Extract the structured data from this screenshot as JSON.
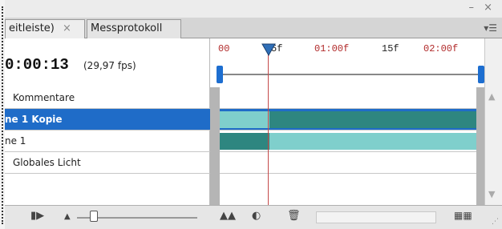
{
  "window": {
    "minimize_label": "–",
    "close_label": "×"
  },
  "tabs": [
    {
      "label": "eitleiste)",
      "close": "×"
    },
    {
      "label": "Messprotokoll"
    }
  ],
  "menu_icon": "panel-menu-icon",
  "timecode": "0:00:13",
  "fps": "(29,97 fps)",
  "ruler": {
    "ticks": [
      "00",
      "5f",
      "01:00f",
      "15f",
      "02:00f"
    ]
  },
  "layers": [
    {
      "name": "Kommentare",
      "selected": false
    },
    {
      "name": "ne 1 Kopie",
      "selected": true
    },
    {
      "name": "ne 1",
      "selected": false
    },
    {
      "name": "Globales Licht",
      "selected": false
    }
  ],
  "colors": {
    "selection": "#1f6cc8",
    "playhead": "#c54a4a",
    "bar_teal": "#7fcfcc",
    "bar_dark": "#2e8680",
    "work_area": "#1d6ed0"
  },
  "bottom_icons": [
    "play-next-frame-icon",
    "zoom-out-icon",
    "zoom-in-icon",
    "convert-icon",
    "delete-icon",
    "animation-mode-icon"
  ]
}
